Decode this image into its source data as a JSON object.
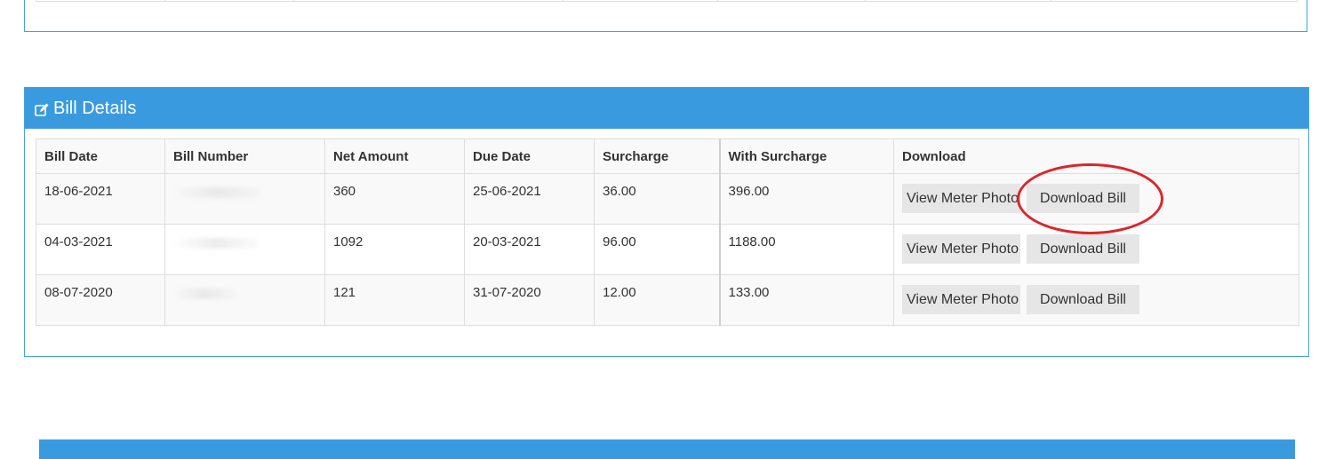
{
  "panel": {
    "title": "Bill Details",
    "icon": "edit-icon"
  },
  "table": {
    "columns": [
      "Bill Date",
      "Bill Number",
      "Net Amount",
      "Due Date",
      "Surcharge",
      "With Surcharge",
      "Download"
    ],
    "rows": [
      {
        "bill_date": "18-06-2021",
        "net_amount": "360",
        "due_date": "25-06-2021",
        "surcharge": "36.00",
        "with_surcharge": "396.00"
      },
      {
        "bill_date": "04-03-2021",
        "net_amount": "1092",
        "due_date": "20-03-2021",
        "surcharge": "96.00",
        "with_surcharge": "1188.00"
      },
      {
        "bill_date": "08-07-2020",
        "net_amount": "121",
        "due_date": "31-07-2020",
        "surcharge": "12.00",
        "with_surcharge": "133.00"
      }
    ],
    "view_meter_label": "View Meter Photo",
    "download_label": "Download Bill"
  },
  "colors": {
    "heading_bg": "#3a9ae0",
    "panel_border": "#4a9fd8",
    "highlight_circle": "#d9262b"
  }
}
